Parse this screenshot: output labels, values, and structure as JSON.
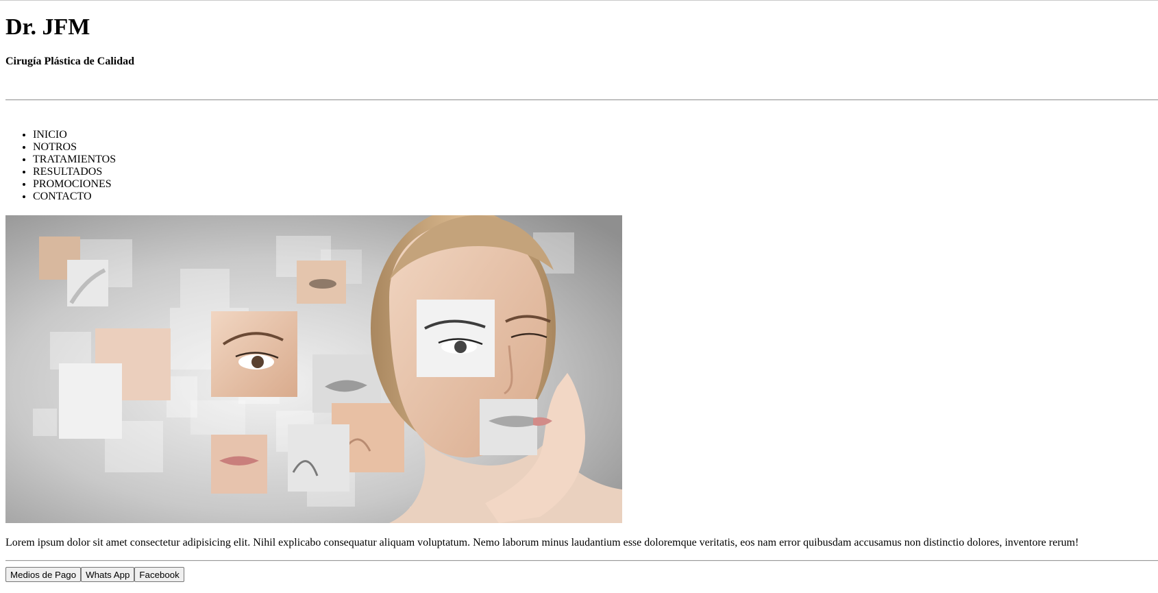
{
  "header": {
    "title": "Dr. JFM",
    "tagline": "Cirugía Plástica de Calidad"
  },
  "nav": {
    "items": [
      {
        "label": "INICIO"
      },
      {
        "label": "NOTROS"
      },
      {
        "label": "TRATAMIENTOS"
      },
      {
        "label": "RESULTADOS"
      },
      {
        "label": "PROMOCIONES"
      },
      {
        "label": "CONTACTO"
      }
    ]
  },
  "hero": {
    "icon": "face-collage-image",
    "colors": {
      "background": "#b5b5b5",
      "skin": "#e8c3a8",
      "hair": "#c9a27c"
    }
  },
  "main": {
    "body_text": "Lorem ipsum dolor sit amet consectetur adipisicing elit. Nihil explicabo consequatur aliquam voluptatum. Nemo laborum minus laudantium esse doloremque veritatis, eos nam error quibusdam accusamus non distinctio dolores, inventore rerum!"
  },
  "footer": {
    "buttons": [
      {
        "label": "Medios de Pago"
      },
      {
        "label": "Whats App"
      },
      {
        "label": "Facebook"
      }
    ]
  }
}
